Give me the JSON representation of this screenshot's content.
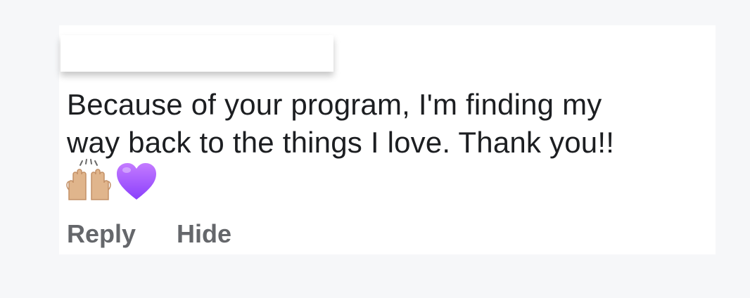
{
  "comment": {
    "text_line_1": "Because of your program, I'm finding my",
    "text_line_2": "way back to the things I love. Thank you!!",
    "emojis": [
      "raising-hands-emoji",
      "purple-heart-emoji"
    ],
    "author_redacted": true
  },
  "actions": {
    "reply_label": "Reply",
    "hide_label": "Hide"
  },
  "colors": {
    "background": "#f6f7f9",
    "card": "#ffffff",
    "text": "#1c1e21",
    "action_text": "#65676b",
    "heart": "#a259ff",
    "skin": "#e0b58c"
  }
}
